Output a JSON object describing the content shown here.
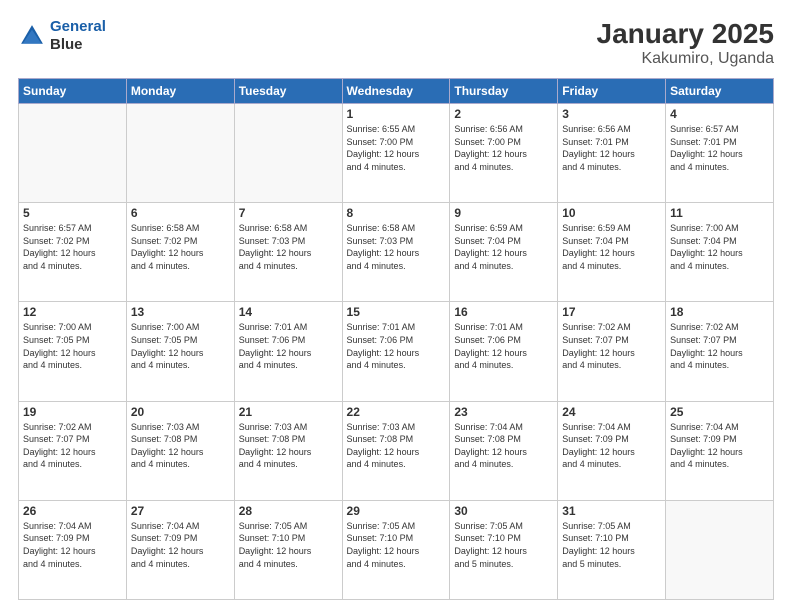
{
  "logo": {
    "line1": "General",
    "line2": "Blue"
  },
  "title": "January 2025",
  "subtitle": "Kakumiro, Uganda",
  "weekdays": [
    "Sunday",
    "Monday",
    "Tuesday",
    "Wednesday",
    "Thursday",
    "Friday",
    "Saturday"
  ],
  "weeks": [
    [
      {
        "day": "",
        "info": ""
      },
      {
        "day": "",
        "info": ""
      },
      {
        "day": "",
        "info": ""
      },
      {
        "day": "1",
        "info": "Sunrise: 6:55 AM\nSunset: 7:00 PM\nDaylight: 12 hours\nand 4 minutes."
      },
      {
        "day": "2",
        "info": "Sunrise: 6:56 AM\nSunset: 7:00 PM\nDaylight: 12 hours\nand 4 minutes."
      },
      {
        "day": "3",
        "info": "Sunrise: 6:56 AM\nSunset: 7:01 PM\nDaylight: 12 hours\nand 4 minutes."
      },
      {
        "day": "4",
        "info": "Sunrise: 6:57 AM\nSunset: 7:01 PM\nDaylight: 12 hours\nand 4 minutes."
      }
    ],
    [
      {
        "day": "5",
        "info": "Sunrise: 6:57 AM\nSunset: 7:02 PM\nDaylight: 12 hours\nand 4 minutes."
      },
      {
        "day": "6",
        "info": "Sunrise: 6:58 AM\nSunset: 7:02 PM\nDaylight: 12 hours\nand 4 minutes."
      },
      {
        "day": "7",
        "info": "Sunrise: 6:58 AM\nSunset: 7:03 PM\nDaylight: 12 hours\nand 4 minutes."
      },
      {
        "day": "8",
        "info": "Sunrise: 6:58 AM\nSunset: 7:03 PM\nDaylight: 12 hours\nand 4 minutes."
      },
      {
        "day": "9",
        "info": "Sunrise: 6:59 AM\nSunset: 7:04 PM\nDaylight: 12 hours\nand 4 minutes."
      },
      {
        "day": "10",
        "info": "Sunrise: 6:59 AM\nSunset: 7:04 PM\nDaylight: 12 hours\nand 4 minutes."
      },
      {
        "day": "11",
        "info": "Sunrise: 7:00 AM\nSunset: 7:04 PM\nDaylight: 12 hours\nand 4 minutes."
      }
    ],
    [
      {
        "day": "12",
        "info": "Sunrise: 7:00 AM\nSunset: 7:05 PM\nDaylight: 12 hours\nand 4 minutes."
      },
      {
        "day": "13",
        "info": "Sunrise: 7:00 AM\nSunset: 7:05 PM\nDaylight: 12 hours\nand 4 minutes."
      },
      {
        "day": "14",
        "info": "Sunrise: 7:01 AM\nSunset: 7:06 PM\nDaylight: 12 hours\nand 4 minutes."
      },
      {
        "day": "15",
        "info": "Sunrise: 7:01 AM\nSunset: 7:06 PM\nDaylight: 12 hours\nand 4 minutes."
      },
      {
        "day": "16",
        "info": "Sunrise: 7:01 AM\nSunset: 7:06 PM\nDaylight: 12 hours\nand 4 minutes."
      },
      {
        "day": "17",
        "info": "Sunrise: 7:02 AM\nSunset: 7:07 PM\nDaylight: 12 hours\nand 4 minutes."
      },
      {
        "day": "18",
        "info": "Sunrise: 7:02 AM\nSunset: 7:07 PM\nDaylight: 12 hours\nand 4 minutes."
      }
    ],
    [
      {
        "day": "19",
        "info": "Sunrise: 7:02 AM\nSunset: 7:07 PM\nDaylight: 12 hours\nand 4 minutes."
      },
      {
        "day": "20",
        "info": "Sunrise: 7:03 AM\nSunset: 7:08 PM\nDaylight: 12 hours\nand 4 minutes."
      },
      {
        "day": "21",
        "info": "Sunrise: 7:03 AM\nSunset: 7:08 PM\nDaylight: 12 hours\nand 4 minutes."
      },
      {
        "day": "22",
        "info": "Sunrise: 7:03 AM\nSunset: 7:08 PM\nDaylight: 12 hours\nand 4 minutes."
      },
      {
        "day": "23",
        "info": "Sunrise: 7:04 AM\nSunset: 7:08 PM\nDaylight: 12 hours\nand 4 minutes."
      },
      {
        "day": "24",
        "info": "Sunrise: 7:04 AM\nSunset: 7:09 PM\nDaylight: 12 hours\nand 4 minutes."
      },
      {
        "day": "25",
        "info": "Sunrise: 7:04 AM\nSunset: 7:09 PM\nDaylight: 12 hours\nand 4 minutes."
      }
    ],
    [
      {
        "day": "26",
        "info": "Sunrise: 7:04 AM\nSunset: 7:09 PM\nDaylight: 12 hours\nand 4 minutes."
      },
      {
        "day": "27",
        "info": "Sunrise: 7:04 AM\nSunset: 7:09 PM\nDaylight: 12 hours\nand 4 minutes."
      },
      {
        "day": "28",
        "info": "Sunrise: 7:05 AM\nSunset: 7:10 PM\nDaylight: 12 hours\nand 4 minutes."
      },
      {
        "day": "29",
        "info": "Sunrise: 7:05 AM\nSunset: 7:10 PM\nDaylight: 12 hours\nand 4 minutes."
      },
      {
        "day": "30",
        "info": "Sunrise: 7:05 AM\nSunset: 7:10 PM\nDaylight: 12 hours\nand 5 minutes."
      },
      {
        "day": "31",
        "info": "Sunrise: 7:05 AM\nSunset: 7:10 PM\nDaylight: 12 hours\nand 5 minutes."
      },
      {
        "day": "",
        "info": ""
      }
    ]
  ]
}
